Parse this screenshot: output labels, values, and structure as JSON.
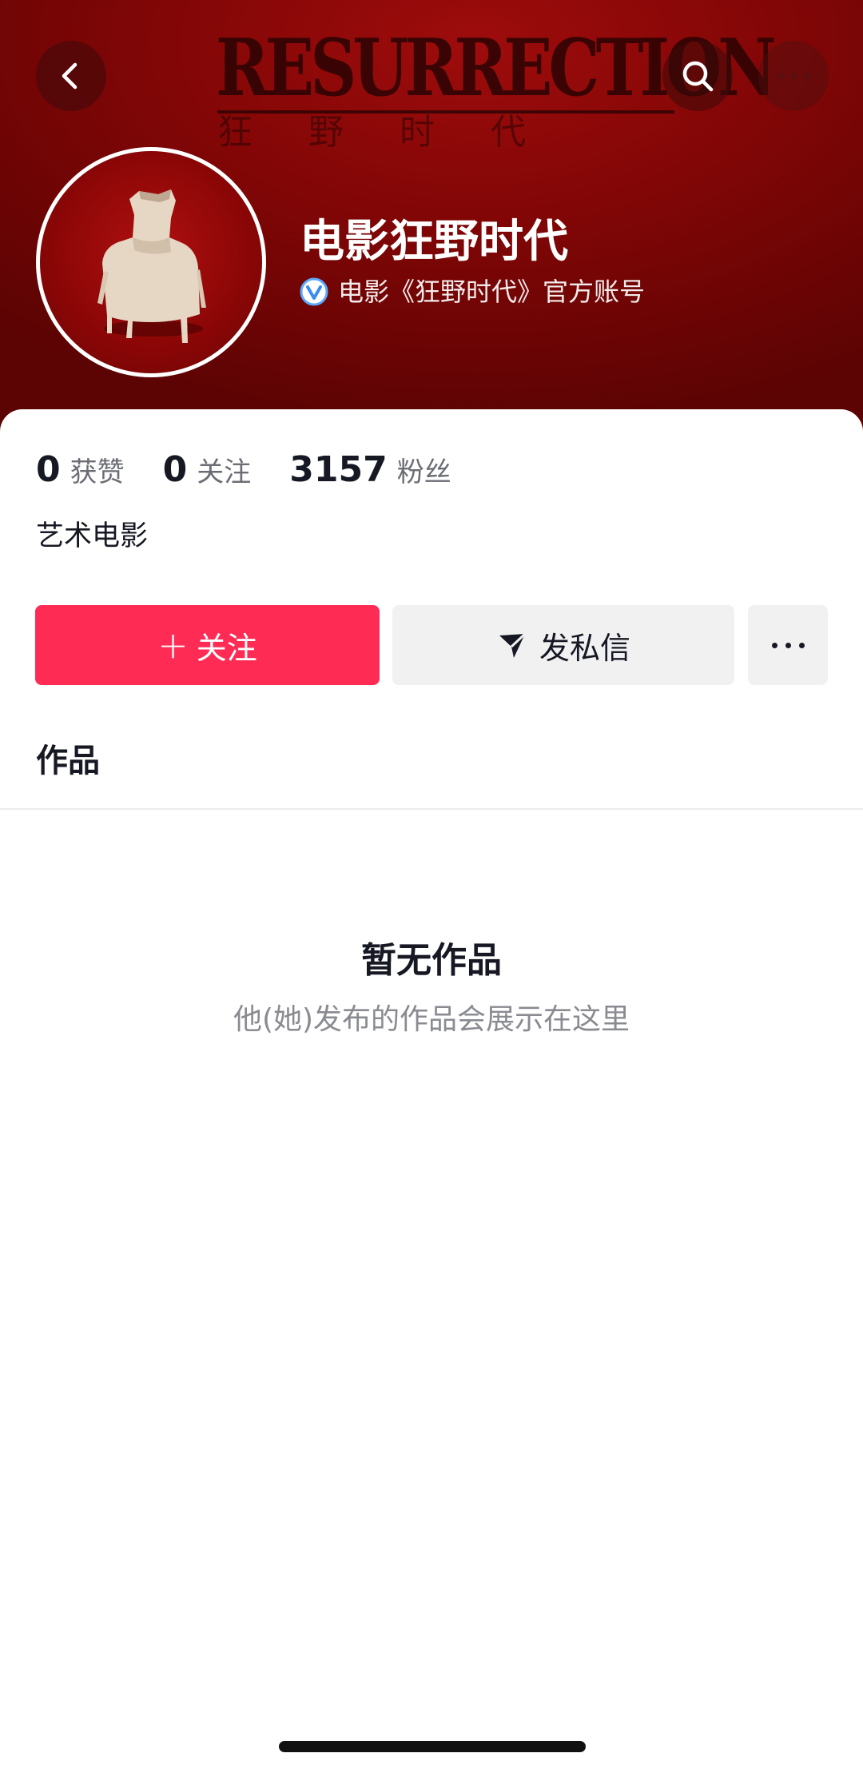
{
  "header": {
    "banner_title": "RESURRECTION",
    "banner_subtitle": "狂野时代",
    "back_icon": "chevron-left-icon",
    "search_icon": "search-icon",
    "more_icon": "more-icon"
  },
  "profile": {
    "name": "电影狂野时代",
    "verified_text": "电影《狂野时代》官方账号",
    "avatar_icon": "avatar"
  },
  "stats": [
    {
      "value": "0",
      "label": "获赞"
    },
    {
      "value": "0",
      "label": "关注"
    },
    {
      "value": "3157",
      "label": "粉丝"
    }
  ],
  "bio": "艺术电影",
  "actions": {
    "follow_label": "关注",
    "follow_plus": "+",
    "dm_label": "发私信"
  },
  "tabs": {
    "works_label": "作品"
  },
  "empty_state": {
    "title": "暂无作品",
    "subtitle": "他(她)发布的作品会展示在这里"
  },
  "colors": {
    "accent": "#fe2c55",
    "banner": "#8a0606",
    "verified": "#5aa9ff"
  }
}
